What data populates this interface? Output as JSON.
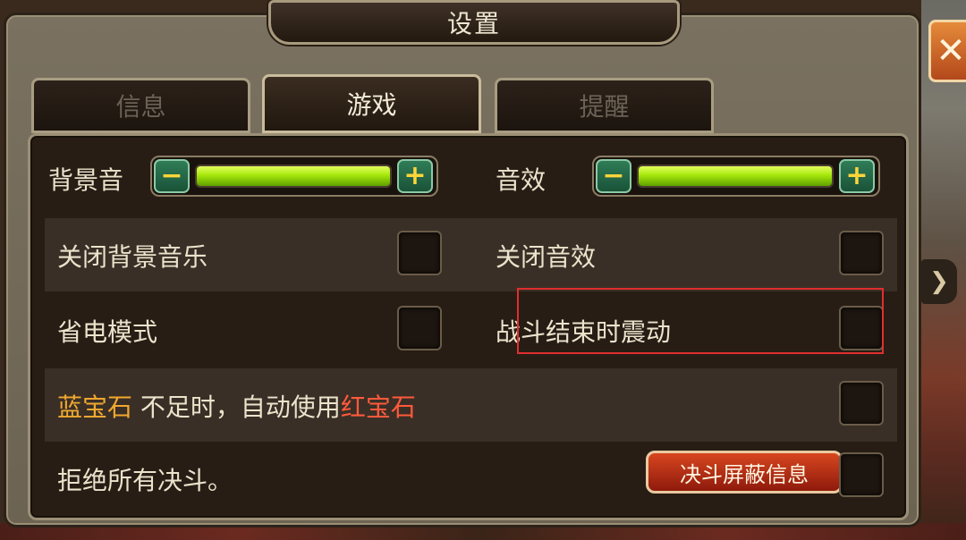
{
  "title": "设置",
  "tabs": [
    {
      "label": "信息",
      "active": false
    },
    {
      "label": "游戏",
      "active": true
    },
    {
      "label": "提醒",
      "active": false
    }
  ],
  "close_label": "✕",
  "side_arrow": "❯",
  "audio": {
    "bgm_label": "背景音",
    "bgm_level": 1.0,
    "sfx_label": "音效",
    "sfx_level": 1.0,
    "minus": "−",
    "plus": "+"
  },
  "options": {
    "mute_bgm": "关闭背景音乐",
    "mute_sfx": "关闭音效",
    "power_save": "省电模式",
    "vibrate": "战斗结束时震动",
    "gem_part1": "蓝宝石",
    "gem_part2": " 不足时，自动使用",
    "gem_part3": "红宝石",
    "refuse_duel": "拒绝所有决斗。",
    "duel_block_button": "决斗屏蔽信息"
  },
  "colors": {
    "accent_gold": "#f0a830",
    "accent_red": "#ff5a3c",
    "slider_fill": "#a6e80c"
  }
}
